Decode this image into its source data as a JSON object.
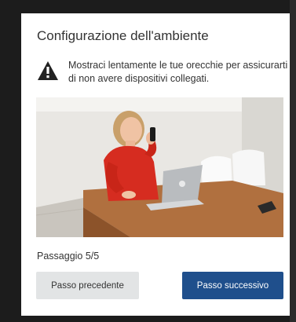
{
  "dialog": {
    "title": "Configurazione dell'ambiente",
    "warning": {
      "icon": "warning-triangle-icon",
      "text": "Mostraci lentamente le tue orecchie per assicurarti di non avere dispositivi collegati."
    },
    "image": {
      "alt": "webcam-preview"
    },
    "step_label": "Passaggio 5/5",
    "buttons": {
      "prev_label": "Passo precedente",
      "next_label": "Passo successivo"
    },
    "colors": {
      "primary": "#1f4f8c",
      "secondary": "#e2e4e5",
      "text": "#333333"
    }
  }
}
